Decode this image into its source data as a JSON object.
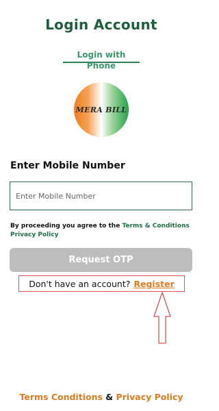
{
  "header": {
    "title": "Login Account"
  },
  "tabs": {
    "login_with_phone": "Login with Phone"
  },
  "logo": {
    "text": "MERA BILL"
  },
  "form": {
    "mobile_label": "Enter Mobile Number",
    "mobile_placeholder": "Enter Mobile Number",
    "mobile_value": "",
    "terms_prefix": "By proceeding you agree to the ",
    "terms_link": "Terms & Conditions",
    "privacy_link": "Privacy Policy",
    "otp_button": "Request OTP"
  },
  "register": {
    "prompt": "Don't have an account?",
    "link": "Register"
  },
  "footer": {
    "terms": "Terms Conditions",
    "and": " & ",
    "privacy": "Privacy Policy"
  },
  "colors": {
    "primary_green": "#1e5f3c",
    "accent_orange": "#e07b1f",
    "button_disabled": "#bdbdbd",
    "highlight_red": "#d9534f"
  }
}
